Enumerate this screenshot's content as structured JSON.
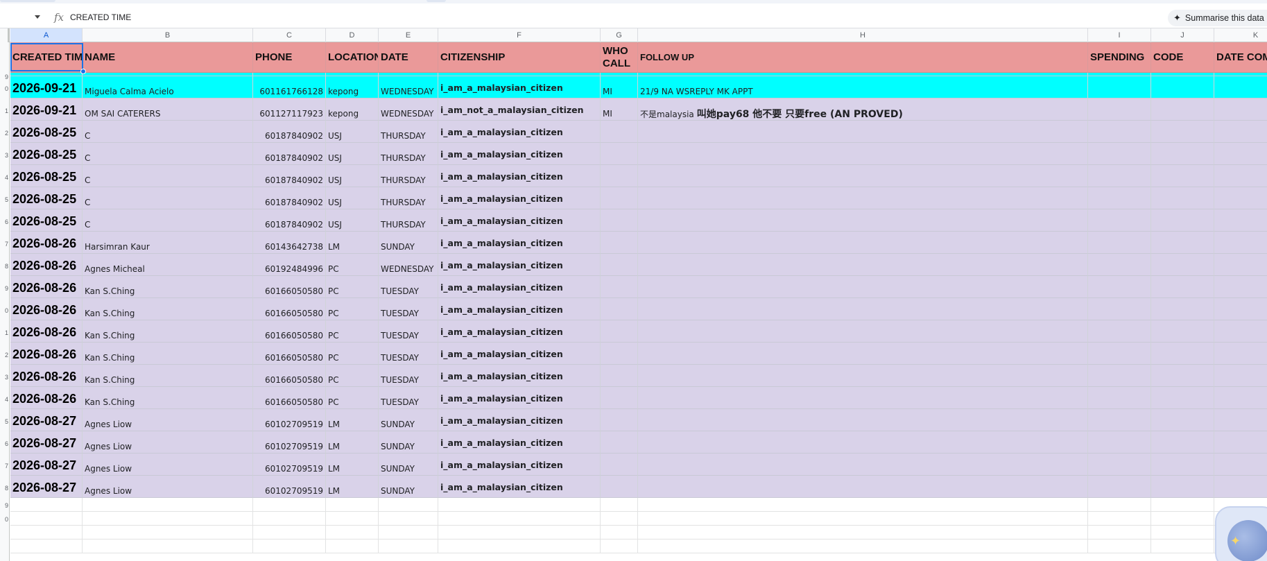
{
  "formula_bar": {
    "fx_symbol": "fx",
    "formula_text": "CREATED TIME",
    "summarise_label": "Summarise this data",
    "sparkle_icon": "sparkle-icon"
  },
  "columns": [
    "A",
    "B",
    "C",
    "D",
    "E",
    "F",
    "G",
    "H",
    "I",
    "J",
    "K"
  ],
  "row_numbers": [
    "",
    "9",
    "0",
    "1",
    "2",
    "3",
    "4",
    "5",
    "6",
    "7",
    "8",
    "9",
    "0",
    "1",
    "2",
    "3",
    "4",
    "5",
    "6",
    "7",
    "8",
    "9",
    "0"
  ],
  "header_row": {
    "created_time": "CREATED TIME",
    "name": "NAME",
    "phone": "PHONE",
    "location": "LOCATION",
    "date": "DATE",
    "citizenship": "CITIZENSHIP",
    "who_call": "WHO CALL",
    "follow_up": "FOLLOW UP",
    "spending": "SPENDING",
    "code": "CODE",
    "date_com": "DATE COM"
  },
  "rows": [
    {
      "created": "2026-09-21",
      "name": "Miguela Calma Acielo",
      "phone": "601161766128",
      "location": "kepong",
      "date": "WEDNESDAY",
      "citizenship": "i_am_a_malaysian_citizen",
      "who": "MI",
      "follow": "21/9 NA WSREPLY MK APPT",
      "follow_bold": ""
    },
    {
      "created": "2026-09-21",
      "name": "OM SAI CATERERS",
      "phone": "601127117923",
      "location": "kepong",
      "date": "WEDNESDAY",
      "citizenship": "i_am_not_a_malaysian_citizen",
      "who": "MI",
      "follow": "不是malaysia",
      "follow_bold": "叫她pay68 他不要 只要free (AN PROVED)"
    },
    {
      "created": "2026-08-25",
      "name": "C",
      "phone": "60187840902",
      "location": "USJ",
      "date": "THURSDAY",
      "citizenship": "i_am_a_malaysian_citizen",
      "who": "",
      "follow": "",
      "follow_bold": ""
    },
    {
      "created": "2026-08-25",
      "name": "C",
      "phone": "60187840902",
      "location": "USJ",
      "date": "THURSDAY",
      "citizenship": "i_am_a_malaysian_citizen",
      "who": "",
      "follow": "",
      "follow_bold": ""
    },
    {
      "created": "2026-08-25",
      "name": "C",
      "phone": "60187840902",
      "location": "USJ",
      "date": "THURSDAY",
      "citizenship": "i_am_a_malaysian_citizen",
      "who": "",
      "follow": "",
      "follow_bold": ""
    },
    {
      "created": "2026-08-25",
      "name": "C",
      "phone": "60187840902",
      "location": "USJ",
      "date": "THURSDAY",
      "citizenship": "i_am_a_malaysian_citizen",
      "who": "",
      "follow": "",
      "follow_bold": ""
    },
    {
      "created": "2026-08-25",
      "name": "C",
      "phone": "60187840902",
      "location": "USJ",
      "date": "THURSDAY",
      "citizenship": "i_am_a_malaysian_citizen",
      "who": "",
      "follow": "",
      "follow_bold": ""
    },
    {
      "created": "2026-08-26",
      "name": "Harsimran Kaur",
      "phone": "60143642738",
      "location": "LM",
      "date": "SUNDAY",
      "citizenship": "i_am_a_malaysian_citizen",
      "who": "",
      "follow": "",
      "follow_bold": ""
    },
    {
      "created": "2026-08-26",
      "name": "Agnes Micheal",
      "phone": "60192484996",
      "location": "PC",
      "date": "WEDNESDAY",
      "citizenship": "i_am_a_malaysian_citizen",
      "who": "",
      "follow": "",
      "follow_bold": ""
    },
    {
      "created": "2026-08-26",
      "name": "Kan S.Ching",
      "phone": "60166050580",
      "location": "PC",
      "date": "TUESDAY",
      "citizenship": "i_am_a_malaysian_citizen",
      "who": "",
      "follow": "",
      "follow_bold": ""
    },
    {
      "created": "2026-08-26",
      "name": "Kan S.Ching",
      "phone": "60166050580",
      "location": "PC",
      "date": "TUESDAY",
      "citizenship": "i_am_a_malaysian_citizen",
      "who": "",
      "follow": "",
      "follow_bold": ""
    },
    {
      "created": "2026-08-26",
      "name": "Kan S.Ching",
      "phone": "60166050580",
      "location": "PC",
      "date": "TUESDAY",
      "citizenship": "i_am_a_malaysian_citizen",
      "who": "",
      "follow": "",
      "follow_bold": ""
    },
    {
      "created": "2026-08-26",
      "name": "Kan S.Ching",
      "phone": "60166050580",
      "location": "PC",
      "date": "TUESDAY",
      "citizenship": "i_am_a_malaysian_citizen",
      "who": "",
      "follow": "",
      "follow_bold": ""
    },
    {
      "created": "2026-08-26",
      "name": "Kan S.Ching",
      "phone": "60166050580",
      "location": "PC",
      "date": "TUESDAY",
      "citizenship": "i_am_a_malaysian_citizen",
      "who": "",
      "follow": "",
      "follow_bold": ""
    },
    {
      "created": "2026-08-26",
      "name": "Kan S.Ching",
      "phone": "60166050580",
      "location": "PC",
      "date": "TUESDAY",
      "citizenship": "i_am_a_malaysian_citizen",
      "who": "",
      "follow": "",
      "follow_bold": ""
    },
    {
      "created": "2026-08-27",
      "name": "Agnes Liow",
      "phone": "60102709519",
      "location": "LM",
      "date": "SUNDAY",
      "citizenship": "i_am_a_malaysian_citizen",
      "who": "",
      "follow": "",
      "follow_bold": ""
    },
    {
      "created": "2026-08-27",
      "name": "Agnes Liow",
      "phone": "60102709519",
      "location": "LM",
      "date": "SUNDAY",
      "citizenship": "i_am_a_malaysian_citizen",
      "who": "",
      "follow": "",
      "follow_bold": ""
    },
    {
      "created": "2026-08-27",
      "name": "Agnes Liow",
      "phone": "60102709519",
      "location": "LM",
      "date": "SUNDAY",
      "citizenship": "i_am_a_malaysian_citizen",
      "who": "",
      "follow": "",
      "follow_bold": ""
    },
    {
      "created": "2026-08-27",
      "name": "Agnes Liow",
      "phone": "60102709519",
      "location": "LM",
      "date": "SUNDAY",
      "citizenship": "i_am_a_malaysian_citizen",
      "who": "",
      "follow": "",
      "follow_bold": ""
    }
  ],
  "colors": {
    "header_bg": "#ea9999",
    "highlight_cyan": "#00ffff",
    "row_lavender": "#d9d2e9",
    "selection_blue": "#1a73e8"
  },
  "side_widget_icon": "globe-sparkle-icon"
}
